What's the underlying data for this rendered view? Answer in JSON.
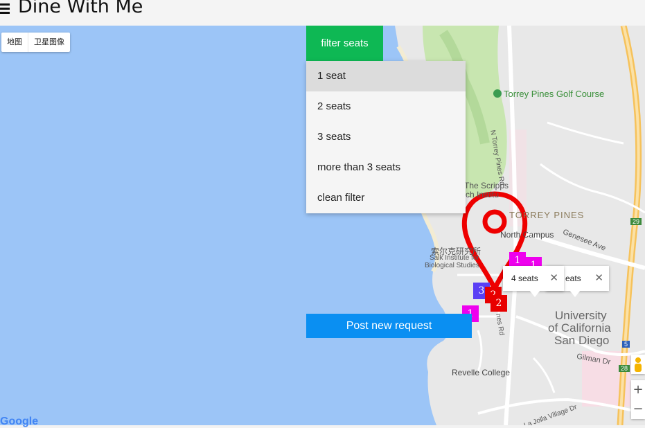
{
  "header": {
    "title": "Dine With Me"
  },
  "map": {
    "type_control": {
      "map": "地图",
      "satellite": "卫星图像"
    },
    "labels": {
      "golf": "Torrey Pines Golf Course",
      "torrey_rd": "N Torrey Pines Rd",
      "scripps": "The Scripps",
      "scripps2": "ch Institu",
      "torrey_pines": "TORREY PINES",
      "north_campus": "North Campus",
      "genesee": "Genesee Ave",
      "salk_cn": "索尔克研究所",
      "salk_en1": "Salk Institute for",
      "salk_en2": "Biological Studies",
      "ucsd1": "University",
      "ucsd2": "of California",
      "ucsd3": "San Diego",
      "revelle": "Revelle College",
      "gilman": "Gilman Dr",
      "la_jolla": "La Jolla Village Dr",
      "pines_rd": "nes Rd",
      "hwy_29": "29",
      "hwy_5": "5",
      "hwy_28": "28"
    },
    "markers": [
      {
        "label": "1",
        "color": "#ee00ee"
      },
      {
        "label": "1",
        "color": "#ee00ee"
      },
      {
        "label": "3",
        "color": "#5a3ff5"
      },
      {
        "label": "2",
        "color": "#e80000"
      },
      {
        "label": "2",
        "color": "#e80000"
      },
      {
        "label": "1",
        "color": "#ee00ee"
      }
    ],
    "info_windows": [
      {
        "text": "4 seats",
        "close": "✕"
      },
      {
        "text": "eats",
        "close": "✕"
      }
    ],
    "zoom": {
      "in": "+",
      "out": "−"
    },
    "attribution": "Google"
  },
  "filter": {
    "button_label": "filter seats",
    "options": [
      "1 seat",
      "2 seats",
      "3 seats",
      "more than 3 seats",
      "clean filter"
    ]
  },
  "post_button": {
    "label": "Post new request"
  },
  "colors": {
    "filter_green": "#0eb854",
    "post_blue": "#0a8ff2",
    "pin_red": "#ee0000",
    "water": "#9cc5f7"
  }
}
